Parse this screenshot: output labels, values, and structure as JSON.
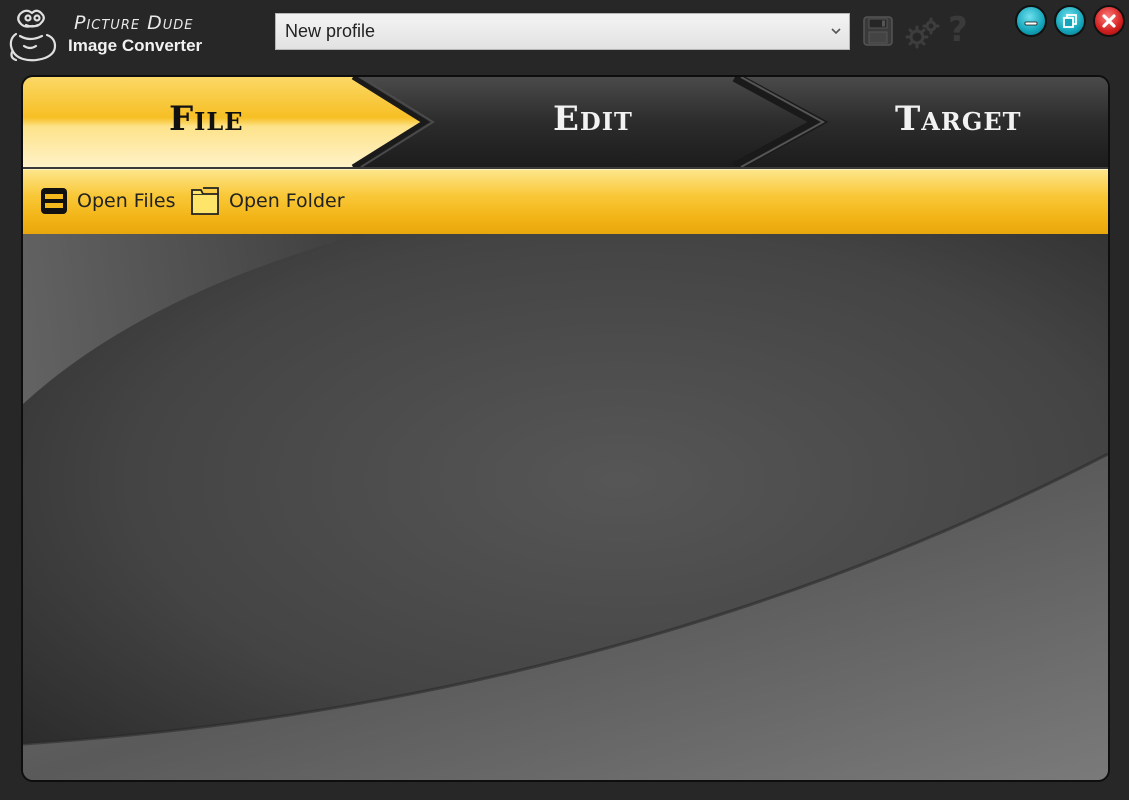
{
  "app": {
    "logo_line1": "Picture Dude",
    "logo_line2": "Image Converter"
  },
  "header": {
    "profile_selected": "New profile"
  },
  "tabs": [
    {
      "label": "File",
      "active": true
    },
    {
      "label": "Edit",
      "active": false
    },
    {
      "label": "Target",
      "active": false
    }
  ],
  "toolbar": {
    "open_files_label": "Open Files",
    "open_folder_label": "Open Folder"
  },
  "icons": {
    "save": "save-icon",
    "settings": "gear-icon",
    "help": "help-icon",
    "minimize": "minimize-icon",
    "maximize": "maximize-icon",
    "close": "close-icon",
    "open_files": "file-icon",
    "open_folder": "folder-icon"
  },
  "colors": {
    "accent": "#f6bd25",
    "background": "#272727",
    "window_button": "#13a5ba",
    "close_button": "#d21f1f"
  }
}
